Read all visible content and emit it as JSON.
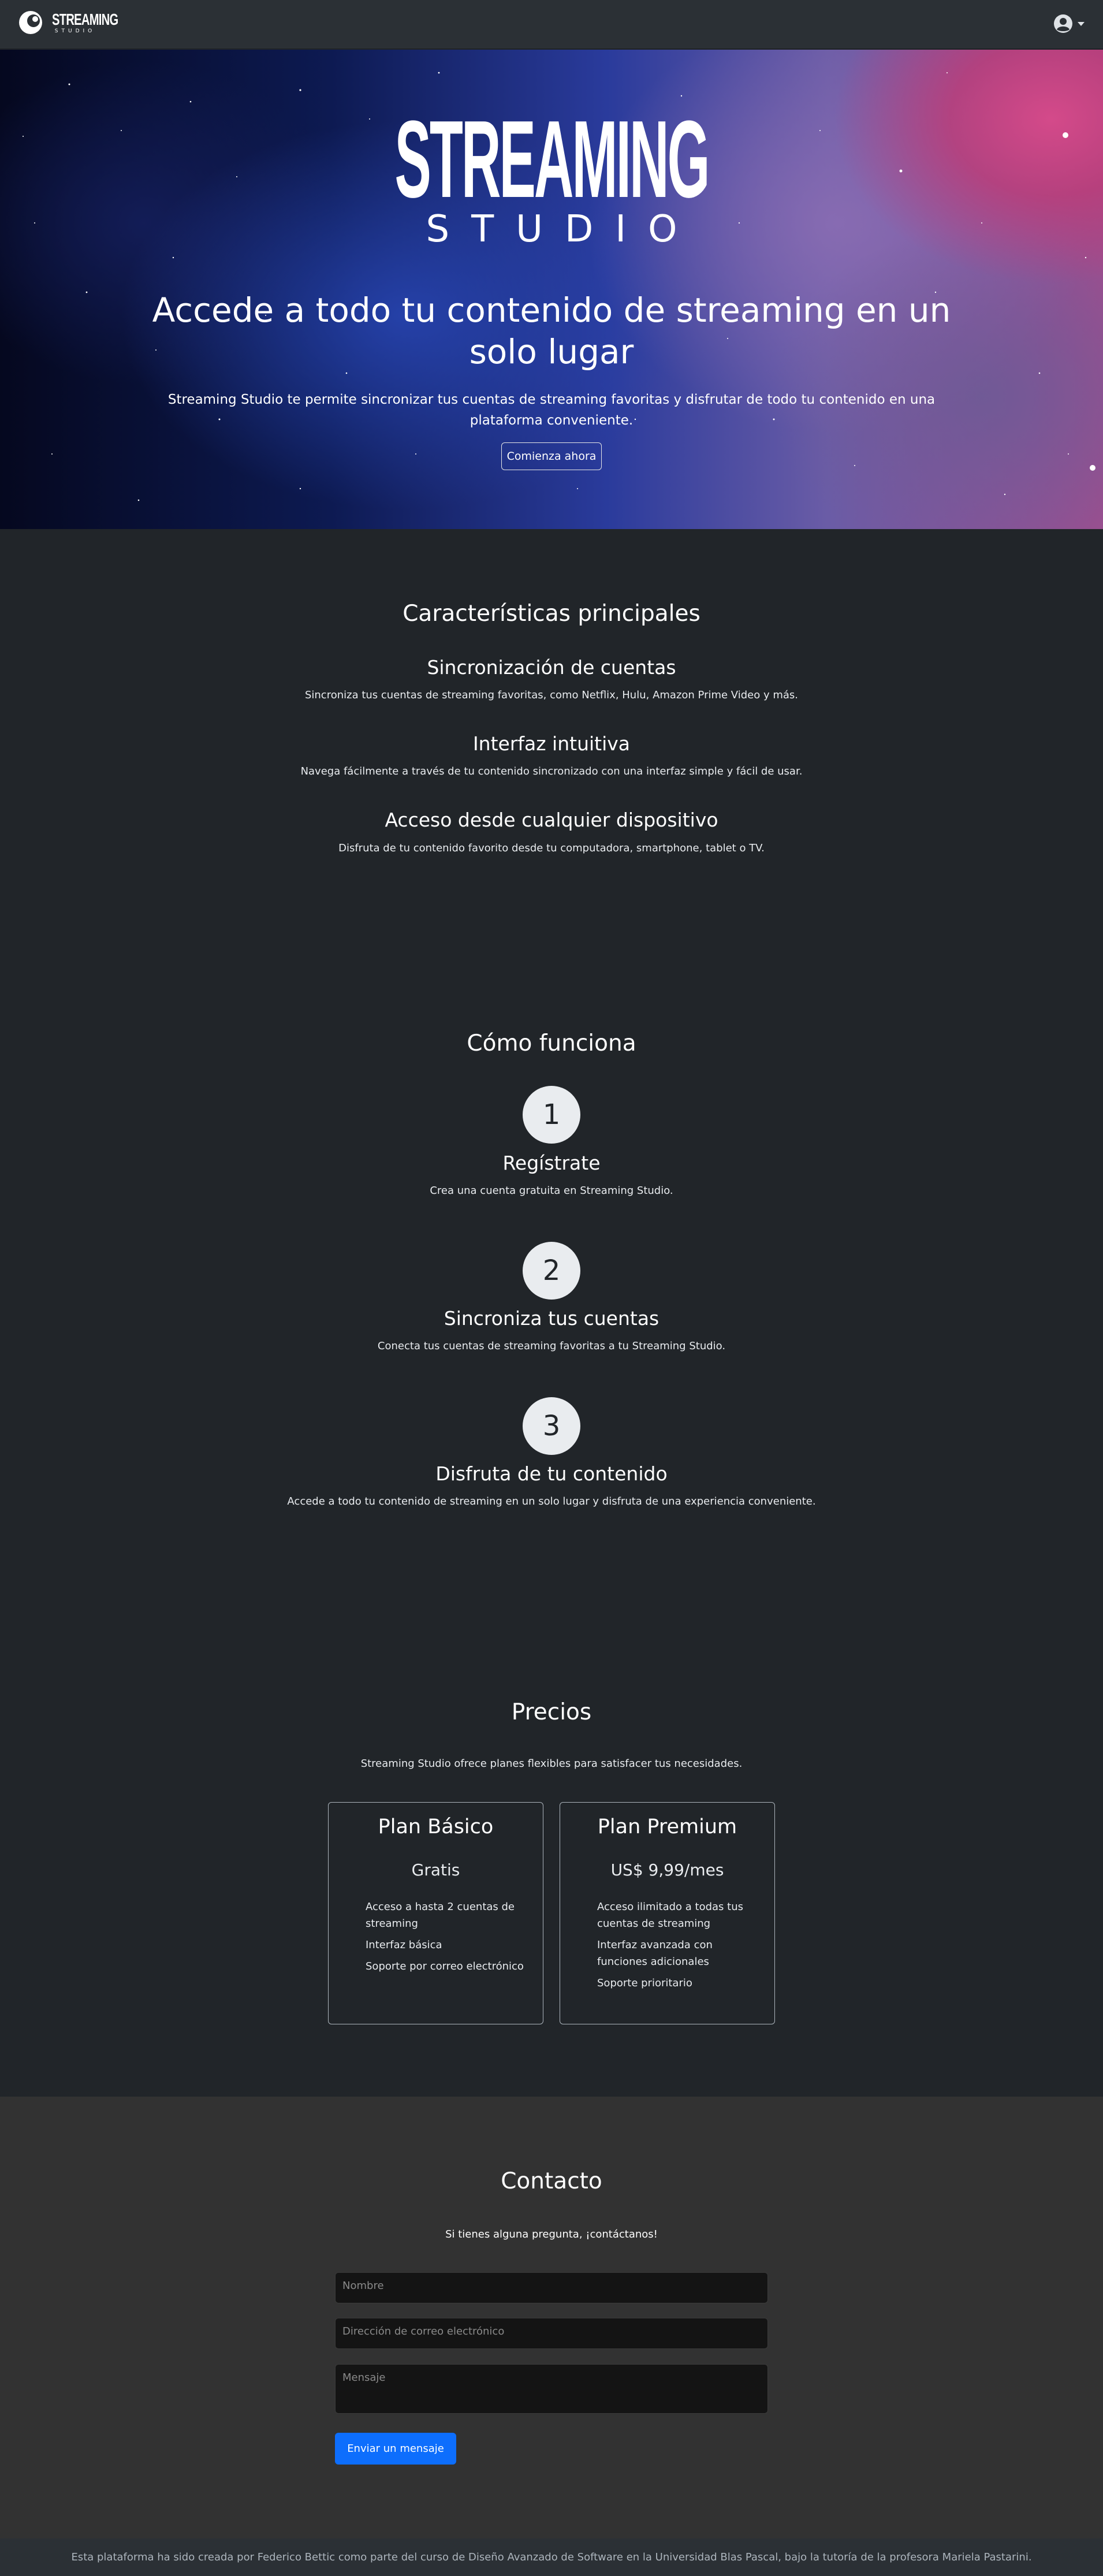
{
  "nav": {
    "brand_line1": "STREAMING",
    "brand_line2": "STUDIO",
    "user_icon": "user-circle-icon"
  },
  "hero": {
    "logo_line1": "STREAMING",
    "logo_line2": "STUDIO",
    "title": "Accede a todo tu contenido de streaming en un solo lugar",
    "subtitle": "Streaming Studio te permite sincronizar tus cuentas de streaming favoritas y disfrutar de todo tu contenido en una plataforma conveniente.",
    "cta_label": "Comienza ahora"
  },
  "features": {
    "title": "Características principales",
    "items": [
      {
        "title": "Sincronización de cuentas",
        "text": "Sincroniza tus cuentas de streaming favoritas, como Netflix, Hulu, Amazon Prime Video y más."
      },
      {
        "title": "Interfaz intuitiva",
        "text": "Navega fácilmente a través de tu contenido sincronizado con una interfaz simple y fácil de usar."
      },
      {
        "title": "Acceso desde cualquier dispositivo",
        "text": "Disfruta de tu contenido favorito desde tu computadora, smartphone, tablet o TV."
      }
    ]
  },
  "how": {
    "title": "Cómo funciona",
    "steps": [
      {
        "number": "1",
        "title": "Regístrate",
        "text": "Crea una cuenta gratuita en Streaming Studio."
      },
      {
        "number": "2",
        "title": "Sincroniza tus cuentas",
        "text": "Conecta tus cuentas de streaming favoritas a tu Streaming Studio."
      },
      {
        "number": "3",
        "title": "Disfruta de tu contenido",
        "text": "Accede a todo tu contenido de streaming en un solo lugar y disfruta de una experiencia conveniente."
      }
    ]
  },
  "pricing": {
    "title": "Precios",
    "subtitle": "Streaming Studio ofrece planes flexibles para satisfacer tus necesidades.",
    "plans": [
      {
        "name": "Plan Básico",
        "price": "Gratis",
        "features": [
          "Acceso a hasta 2 cuentas de streaming",
          "Interfaz básica",
          "Soporte por correo electrónico"
        ]
      },
      {
        "name": "Plan Premium",
        "price": "US$ 9,99/mes",
        "features": [
          "Acceso ilimitado a todas tus cuentas de streaming",
          "Interfaz avanzada con funciones adicionales",
          "Soporte prioritario"
        ]
      }
    ]
  },
  "contact": {
    "title": "Contacto",
    "subtitle": "Si tienes alguna pregunta, ¡contáctanos!",
    "name_placeholder": "Nombre",
    "email_placeholder": "Dirección de correo electrónico",
    "message_placeholder": "Mensaje",
    "send_label": "Enviar un mensaje"
  },
  "footer": {
    "text": "Esta plataforma ha sido creada por Federico Bettic como parte del curso de Diseño Avanzado de Software en la Universidad Blas Pascal, bajo la tutoría de la profesora Mariela Pastarini."
  },
  "colors": {
    "page_bg": "#212529",
    "nav_bg": "#2b3035",
    "contact_bg": "#323232",
    "accent": "#0d6efd"
  }
}
